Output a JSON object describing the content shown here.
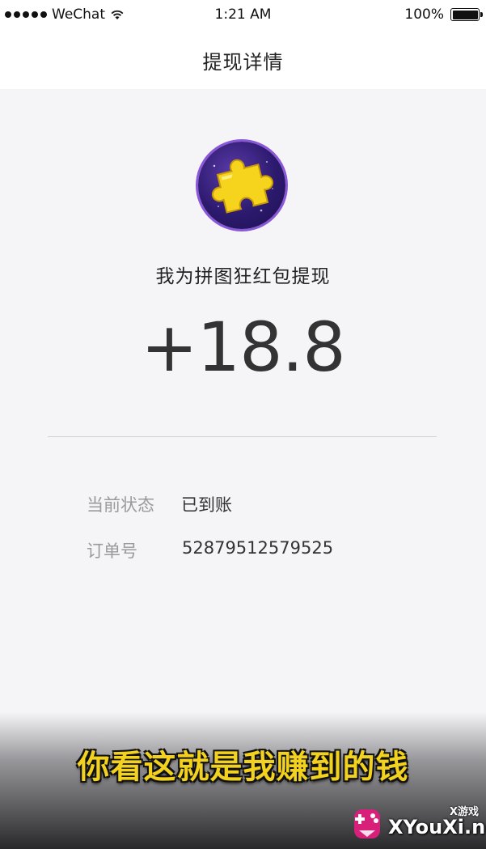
{
  "status_bar": {
    "carrier": "WeChat",
    "time": "1:21 AM",
    "battery": "100%"
  },
  "nav": {
    "title": "提现详情"
  },
  "withdrawal": {
    "app_icon": "jigsaw-puzzle-icon",
    "title": "我为拼图狂红包提现",
    "amount": "+18.8",
    "details": [
      {
        "label": "当前状态",
        "value": "已到账"
      },
      {
        "label": "订单号",
        "value": "52879512579525"
      }
    ]
  },
  "overlay": {
    "subtitle": "你看这就是我赚到的钱",
    "watermark_tag": "X游戏",
    "watermark_site": "XYouXi.net",
    "subtitle_color": "#f2d21e"
  }
}
